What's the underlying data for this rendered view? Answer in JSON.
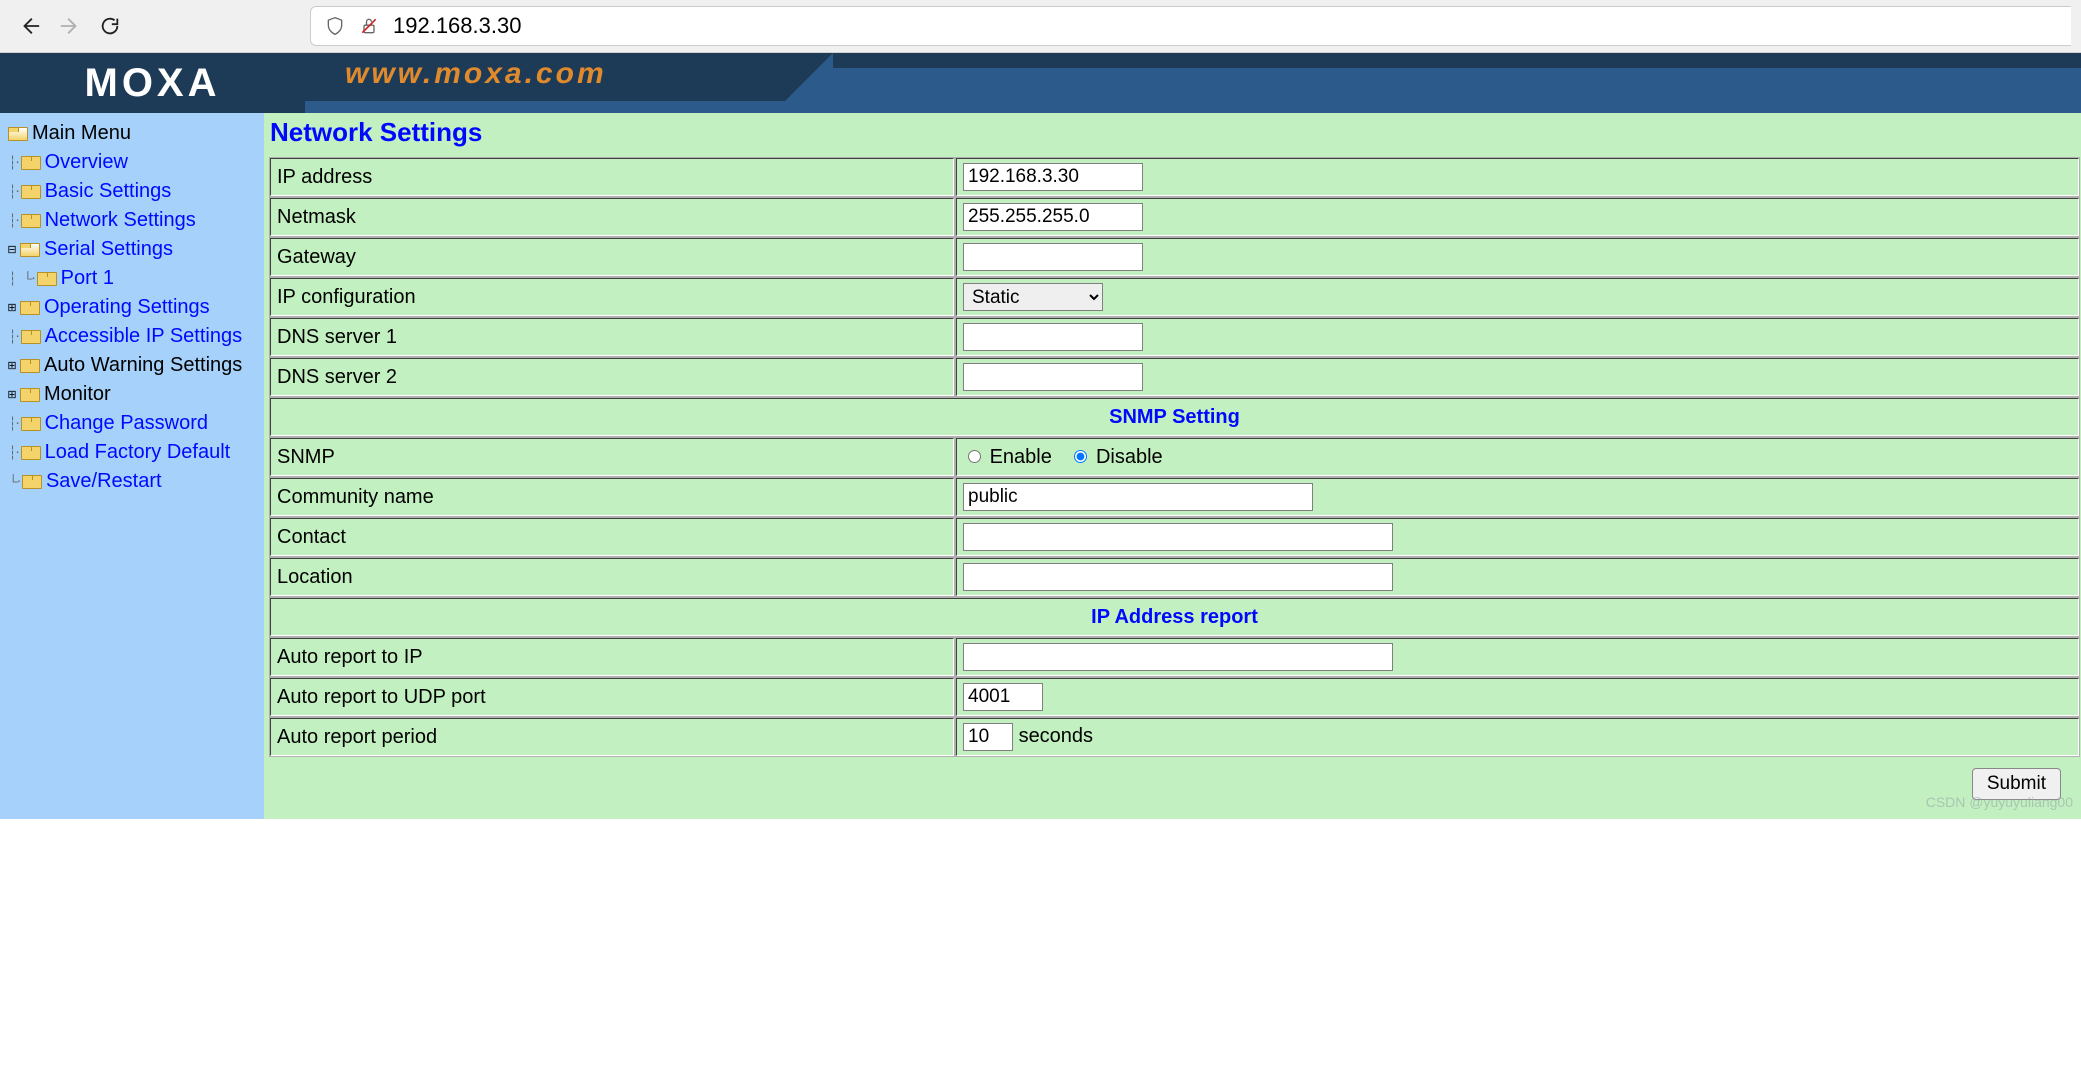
{
  "browser": {
    "url": "192.168.3.30"
  },
  "brand": {
    "logo_text": "MOXA",
    "site_url": "www.moxa.com"
  },
  "sidebar": {
    "root": "Main Menu",
    "items": [
      {
        "label": "Overview",
        "link": true
      },
      {
        "label": "Basic Settings",
        "link": true
      },
      {
        "label": "Network Settings",
        "link": true
      },
      {
        "label": "Serial Settings",
        "link": true,
        "exp": "minus",
        "children": [
          {
            "label": "Port 1",
            "link": true
          }
        ]
      },
      {
        "label": "Operating Settings",
        "link": true,
        "exp": "plus"
      },
      {
        "label": "Accessible IP Settings",
        "link": true
      },
      {
        "label": "Auto Warning Settings",
        "link": false,
        "exp": "plus"
      },
      {
        "label": "Monitor",
        "link": false,
        "exp": "plus"
      },
      {
        "label": "Change Password",
        "link": true
      },
      {
        "label": "Load Factory Default",
        "link": true
      },
      {
        "label": "Save/Restart",
        "link": true
      }
    ]
  },
  "page": {
    "title": "Network Settings"
  },
  "form": {
    "ip_address": {
      "label": "IP address",
      "value": "192.168.3.30"
    },
    "netmask": {
      "label": "Netmask",
      "value": "255.255.255.0"
    },
    "gateway": {
      "label": "Gateway",
      "value": ""
    },
    "ip_config": {
      "label": "IP configuration",
      "value": "Static",
      "options": [
        "Static"
      ]
    },
    "dns1": {
      "label": "DNS server 1",
      "value": ""
    },
    "dns2": {
      "label": "DNS server 2",
      "value": ""
    },
    "section_snmp": "SNMP Setting",
    "snmp": {
      "label": "SNMP",
      "enable": "Enable",
      "disable": "Disable",
      "value": "Disable"
    },
    "community": {
      "label": "Community name",
      "value": "public"
    },
    "contact": {
      "label": "Contact",
      "value": ""
    },
    "location": {
      "label": "Location",
      "value": ""
    },
    "section_report": "IP Address report",
    "report_ip": {
      "label": "Auto report to IP",
      "value": ""
    },
    "report_port": {
      "label": "Auto report to UDP port",
      "value": "4001"
    },
    "report_period": {
      "label": "Auto report period",
      "value": "10",
      "unit": "seconds"
    },
    "submit_label": "Submit"
  },
  "watermark": "CSDN @yuyuyuliang00"
}
